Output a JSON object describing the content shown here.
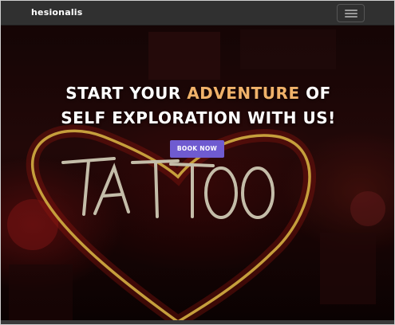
{
  "navbar": {
    "brand": "hesionalis",
    "toggler_icon": "hamburger-menu-icon"
  },
  "hero": {
    "line1_before": "START YOUR ",
    "line1_accent": "ADVENTURE",
    "line1_after": " OF",
    "line2": "SELF EXPLORATION WITH US!",
    "book_button_label": "BOOK NOW",
    "neon_sign_text": "TATTOO"
  },
  "colors": {
    "navbar_bg": "#303030",
    "accent_text": "#f0b26a",
    "button_bg": "#6f5bd0",
    "neon_heart": "#f2c24a",
    "neon_text": "#efe7cf"
  }
}
